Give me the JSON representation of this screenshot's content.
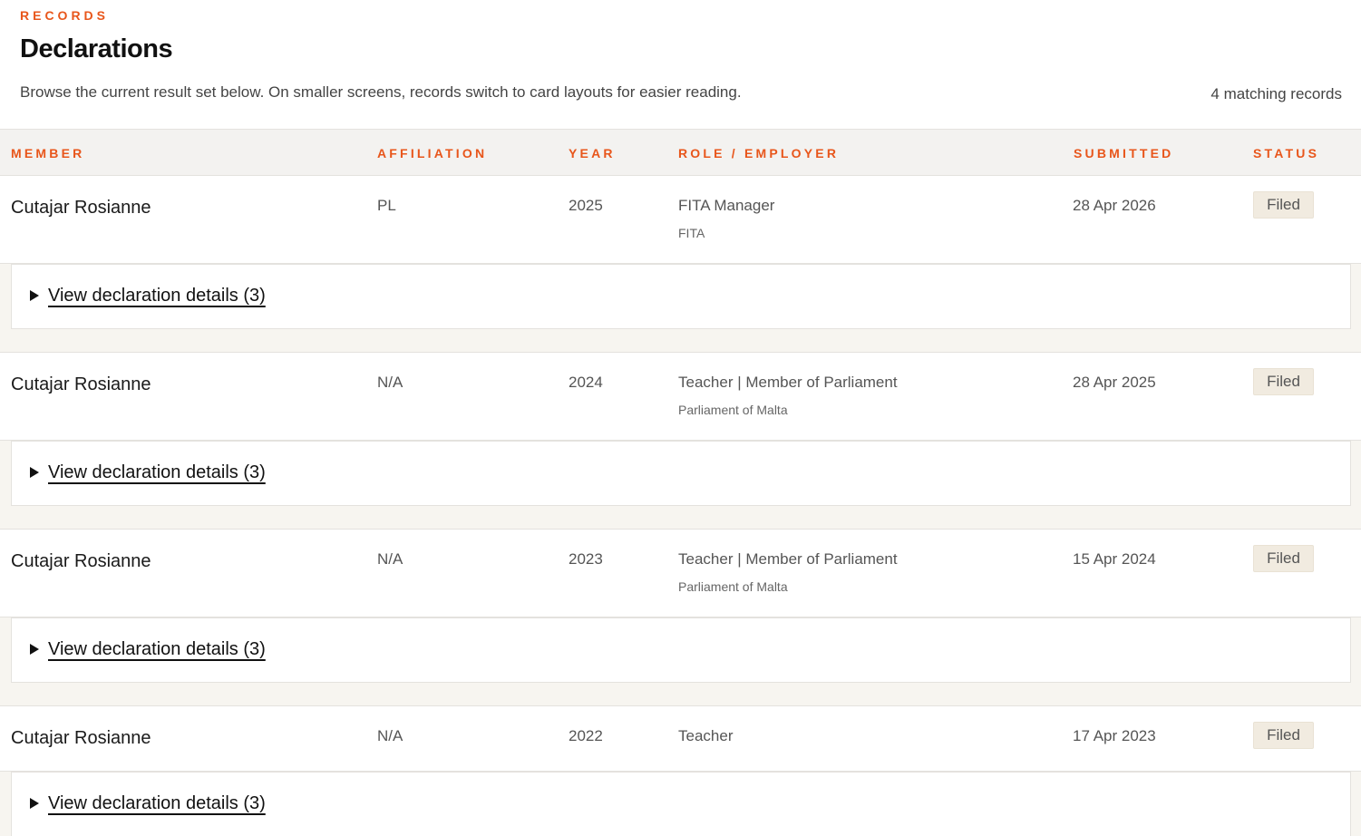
{
  "header": {
    "eyebrow": "RECORDS",
    "title": "Declarations",
    "intro": "Browse the current result set below. On smaller screens, records switch to card layouts for easier reading.",
    "count": "4 matching records"
  },
  "table": {
    "columns": [
      "MEMBER",
      "AFFILIATION",
      "YEAR",
      "ROLE / EMPLOYER",
      "SUBMITTED",
      "STATUS"
    ],
    "rows": [
      {
        "member": "Cutajar Rosianne",
        "affiliation": "PL",
        "year": "2025",
        "role": "FITA Manager",
        "employer": "FITA",
        "submitted": "28 Apr 2026",
        "status": "Filed",
        "details": "View declaration details (3)"
      },
      {
        "member": "Cutajar Rosianne",
        "affiliation": "N/A",
        "year": "2024",
        "role": "Teacher | Member of Parliament",
        "employer": "Parliament of Malta",
        "submitted": "28 Apr 2025",
        "status": "Filed",
        "details": "View declaration details (3)"
      },
      {
        "member": "Cutajar Rosianne",
        "affiliation": "N/A",
        "year": "2023",
        "role": "Teacher | Member of Parliament",
        "employer": "Parliament of Malta",
        "submitted": "15 Apr 2024",
        "status": "Filed",
        "details": "View declaration details (3)"
      },
      {
        "member": "Cutajar Rosianne",
        "affiliation": "N/A",
        "year": "2022",
        "role": "Teacher",
        "employer": "",
        "submitted": "17 Apr 2023",
        "status": "Filed",
        "details": "View declaration details (3)"
      }
    ]
  },
  "colors": {
    "accent": "#e8561b",
    "badge_bg": "#f1ebe0",
    "header_bg": "#f3f2f0"
  },
  "icons": {
    "details_toggle": "disclosure-triangle-right-icon"
  }
}
